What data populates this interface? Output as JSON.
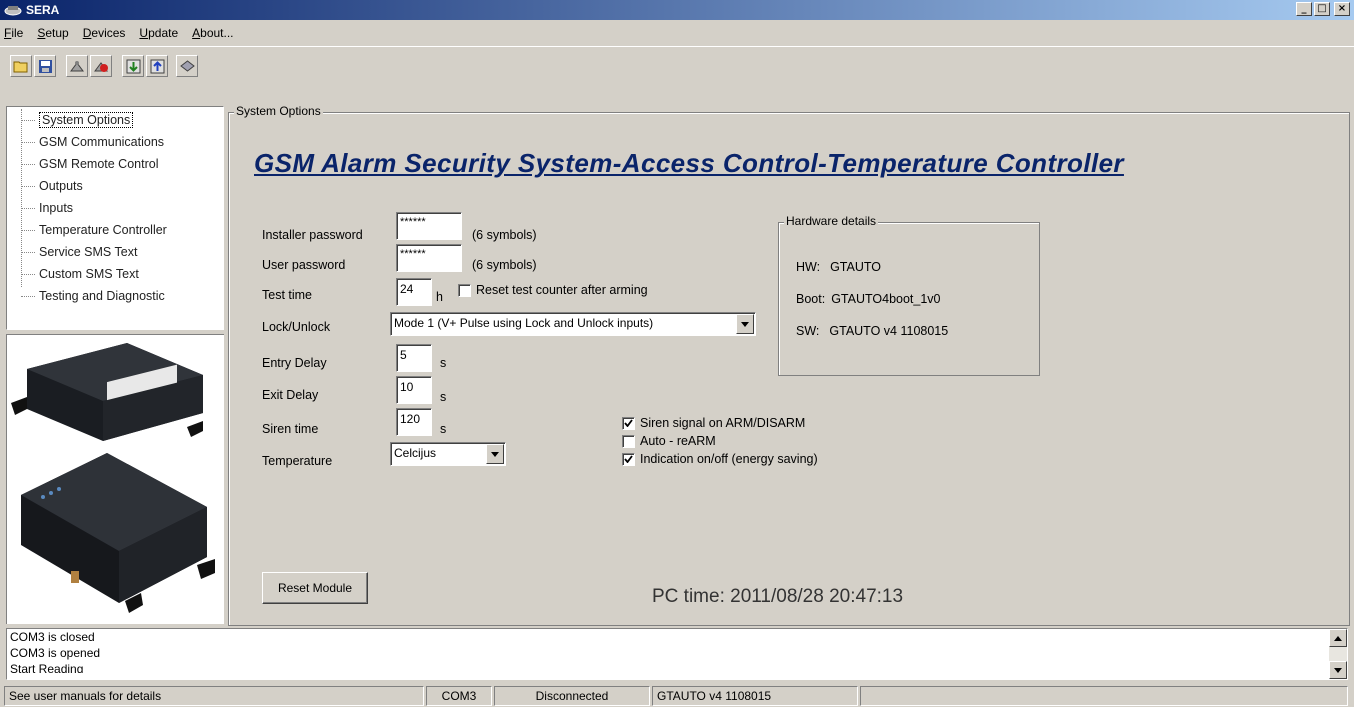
{
  "window": {
    "title": "SERA"
  },
  "menu": [
    {
      "label": "File",
      "key": "F",
      "rest": "ile"
    },
    {
      "label": "Setup",
      "key": "S",
      "rest": "etup"
    },
    {
      "label": "Devices",
      "key": "D",
      "rest": "evices"
    },
    {
      "label": "Update",
      "key": "U",
      "rest": "pdate"
    },
    {
      "label": "About...",
      "key": "A",
      "rest": "bout..."
    }
  ],
  "toolbar": {
    "icons": [
      "open-folder-icon",
      "save-icon",
      "connect-icon",
      "disconnect-icon",
      "read-device-icon",
      "write-device-icon",
      "firmware-icon"
    ]
  },
  "tree": {
    "items": [
      "System Options",
      "GSM Communications",
      "GSM Remote Control",
      "Outputs",
      "Inputs",
      "Temperature Controller",
      "Service SMS Text",
      "Custom SMS Text",
      "Testing and Diagnostic"
    ],
    "selected": "System Options"
  },
  "main": {
    "group_label": "System Options",
    "headline": "GSM Alarm Security System-Access Control-Temperature Controller",
    "installer_password": {
      "label": "Installer password",
      "value": "******",
      "hint": "(6 symbols)"
    },
    "user_password": {
      "label": "User password",
      "value": "******",
      "hint": "(6 symbols)"
    },
    "test_time": {
      "label": "Test time",
      "value": "24",
      "unit": "h",
      "reset_label": "Reset test counter after arming",
      "reset_checked": false
    },
    "lock_unlock": {
      "label": "Lock/Unlock",
      "value": "Mode 1 (V+ Pulse using Lock and Unlock inputs)"
    },
    "entry_delay": {
      "label": "Entry Delay",
      "value": "5",
      "unit": "s"
    },
    "exit_delay": {
      "label": "Exit Delay",
      "value": "10",
      "unit": "s"
    },
    "siren_time": {
      "label": "Siren time",
      "value": "120",
      "unit": "s"
    },
    "temperature": {
      "label": "Temperature",
      "value": "Celcijus"
    },
    "options": [
      {
        "label": "Siren signal on ARM/DISARM",
        "checked": true
      },
      {
        "label": "Auto - reARM",
        "checked": false
      },
      {
        "label": "Indication on/off (energy saving)",
        "checked": true
      }
    ],
    "hardware": {
      "title": "Hardware details",
      "hw_label": "HW:",
      "hw_value": "GTAUTO",
      "boot_label": "Boot:",
      "boot_value": "GTAUTO4boot_1v0",
      "sw_label": "SW:",
      "sw_value": "GTAUTO v4 1108015"
    },
    "reset_button": "Reset Module",
    "pc_time": "PC time: 2011/08/28 20:47:13"
  },
  "log": [
    "COM3 is closed",
    "COM3 is opened",
    "Start Reading"
  ],
  "status": {
    "hint": "See user manuals for details",
    "port": "COM3",
    "connection": "Disconnected",
    "firmware": "GTAUTO v4 1108015"
  },
  "colors": {
    "titlebar_start": "#0a246a",
    "titlebar_end": "#a6caf0",
    "headline": "#0a246a",
    "face": "#d4d0c8"
  }
}
